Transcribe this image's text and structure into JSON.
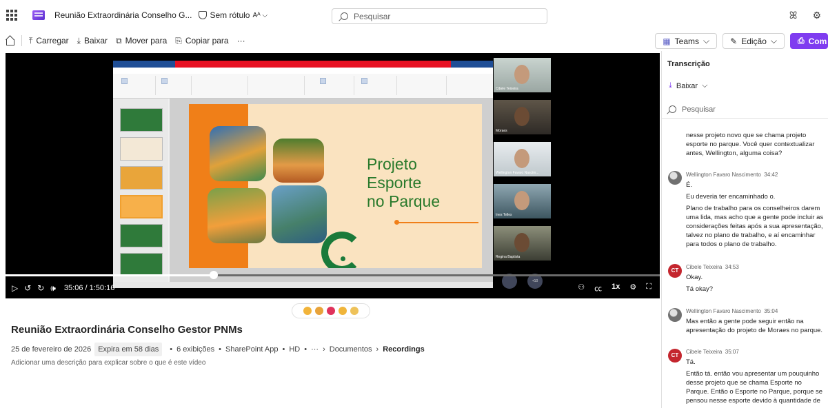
{
  "topbar": {
    "doc_title": "Reunião Extraordinária Conselho G...",
    "sensitivity": "Sem rótulo",
    "search_placeholder": "Pesquisar"
  },
  "commands": {
    "upload": "Carregar",
    "download": "Baixar",
    "move": "Mover para",
    "copy": "Copiar para",
    "more": "···",
    "teams": "Teams",
    "edit": "Edição",
    "share": "Comp"
  },
  "video": {
    "slide_title_line1": "Projeto",
    "slide_title_line2": "Esporte",
    "slide_title_line3": "no Parque",
    "time": "35:06 / 1:50:16",
    "speed": "1x",
    "progress": 0.318,
    "participants": [
      "Cibele Teixeira",
      "Moraes",
      "Wellington Favaro Nascim...",
      "Ines Telles",
      "Regina Baptista"
    ],
    "bubble_count": "+10"
  },
  "reactions": [
    "thumbs-up",
    "laugh",
    "heart",
    "surprised",
    "clap"
  ],
  "details": {
    "title": "Reunião Extraordinária Conselho Gestor PNMs",
    "date": "25 de fevereiro de 2026",
    "expires": "Expira em 58 dias",
    "views": "6 exibições",
    "app": "SharePoint App",
    "quality": "HD",
    "ellipsis": "···",
    "crumb1": "Documentos",
    "crumb2": "Recordings",
    "description": "Adicionar uma descrição para explicar sobre o que é este vídeo"
  },
  "transcript": {
    "title": "Transcrição",
    "download": "Baixar",
    "search_placeholder": "Pesquisar",
    "lead_text": "nesse projeto novo que se chama projeto esporte no parque. Você quer contextualizar antes, Wellington, alguma coisa?",
    "entries": [
      {
        "name": "Wellington Favaro Nascimento",
        "time": "34:42",
        "lines": [
          "É.",
          "Eu deveria ter encaminhado o.",
          "Plano de trabalho para os conselheiros darem uma lida, mas acho que a gente pode incluir as considerações feitas após a sua apresentação, talvez no plano de trabalho, e aí encaminhar para todos o plano de trabalho."
        ]
      },
      {
        "name": "Cibele Teixeira",
        "time": "34:53",
        "initials": "CT",
        "lines": [
          "Okay.",
          "Tá okay?"
        ]
      },
      {
        "name": "Wellington Favaro Nascimento",
        "time": "35:04",
        "lines": [
          "Mas então a gente pode seguir então na apresentação do projeto de Moraes no parque."
        ]
      },
      {
        "name": "Cibele Teixeira",
        "time": "35:07",
        "initials": "CT",
        "lines": [
          "Tá.",
          "Então tá. então vou apresentar um pouquinho desse projeto que se chama Esporte no Parque. Então o Esporte no Parque, porque se pensou nesse esporte devido à quantidade de pessoas"
        ]
      }
    ]
  },
  "colors": {
    "accent": "#7f3cf0",
    "avatar_ct": "#c4262e",
    "slide_green": "#2a7a2c",
    "slide_orange": "#f07f18"
  }
}
